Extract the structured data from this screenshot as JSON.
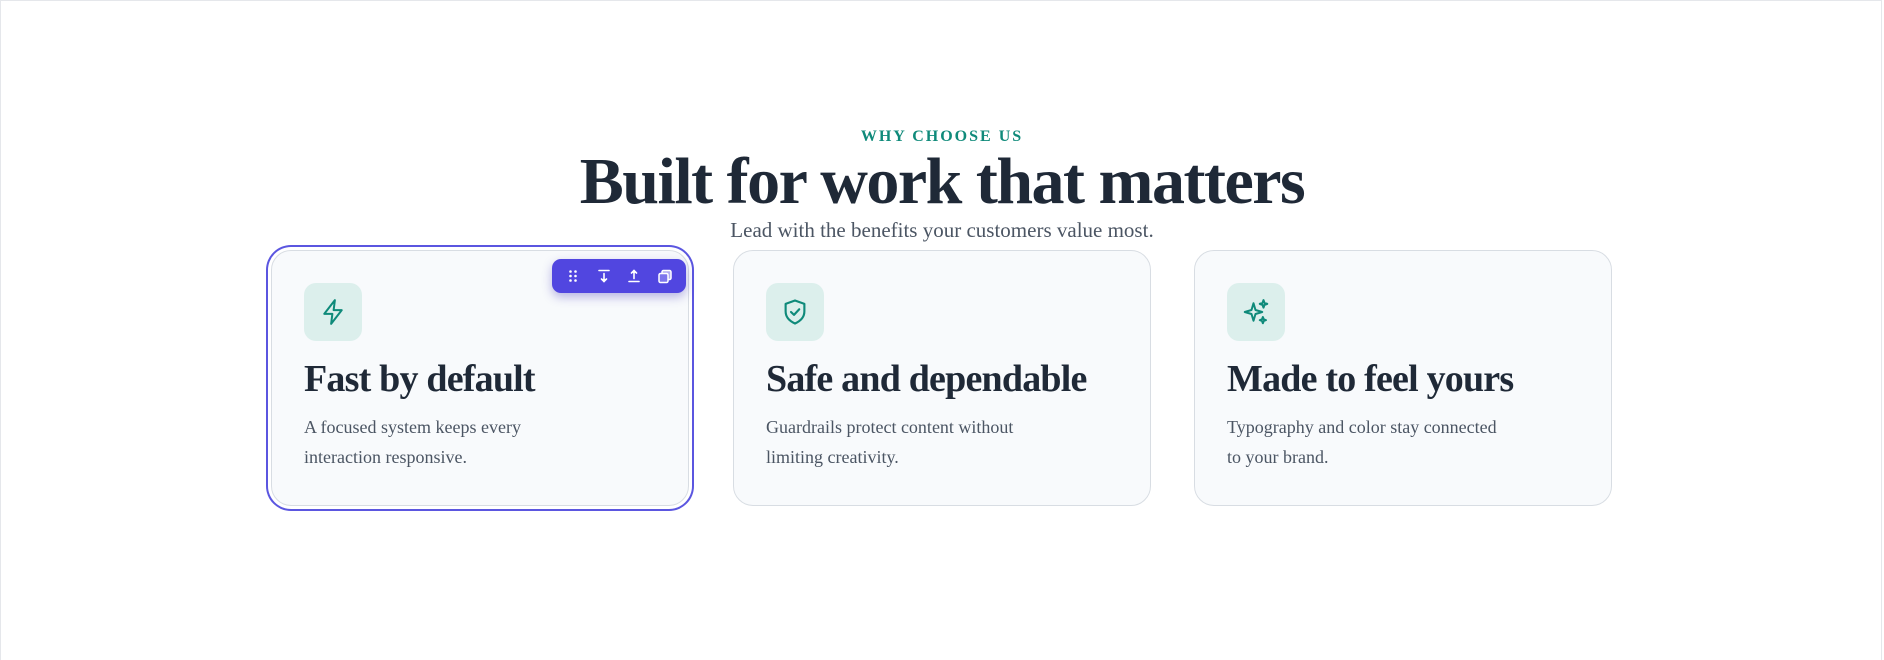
{
  "header": {
    "eyebrow": "WHY CHOOSE US",
    "title": "Built for work that matters",
    "subtitle": "Lead with the benefits your customers value most."
  },
  "cards": [
    {
      "icon": "lightning-icon",
      "title": "Fast by default",
      "body": "A focused system keeps every interaction responsive.",
      "selected": true
    },
    {
      "icon": "shield-check-icon",
      "title": "Safe and dependable",
      "body": "Guardrails protect content without limiting creativity.",
      "selected": false
    },
    {
      "icon": "sparkles-icon",
      "title": "Made to feel yours",
      "body": "Typography and color stay connected to your brand.",
      "selected": false
    }
  ],
  "toolbar": {
    "buttons": [
      "drag-handle-icon",
      "move-down-icon",
      "move-up-icon",
      "duplicate-icon"
    ]
  },
  "colors": {
    "accent": "#0f8a7a",
    "heading": "#1f2937",
    "body": "#4b5563",
    "selection": "#5146e0",
    "icon_tile": "#dcefec",
    "card_bg": "#f8fafc"
  }
}
